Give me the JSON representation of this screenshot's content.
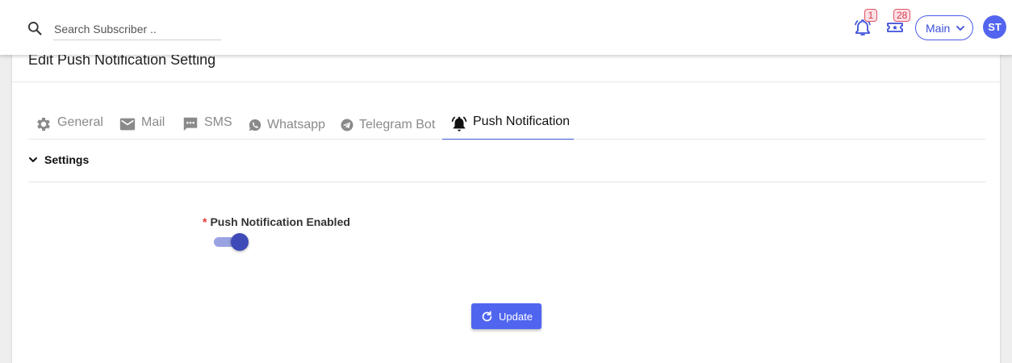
{
  "header": {
    "search": {
      "placeholder": "Search Subscriber .."
    },
    "notifications": {
      "count": "1",
      "icon": "bell-icon"
    },
    "tickets": {
      "count": "28",
      "icon": "ticket-icon"
    },
    "workspace_select": {
      "value": "Main"
    },
    "avatar": {
      "initials": "ST"
    }
  },
  "card": {
    "title": "Edit Push Notification Setting",
    "tabs": [
      {
        "label": "General",
        "icon": "gear-icon",
        "active": false
      },
      {
        "label": "Mail",
        "icon": "mail-icon",
        "active": false
      },
      {
        "label": "SMS",
        "icon": "sms-icon",
        "active": false
      },
      {
        "label": "Whatsapp",
        "icon": "whatsapp-icon",
        "active": false
      },
      {
        "label": "Telegram Bot",
        "icon": "telegram-icon",
        "active": false
      },
      {
        "label": "Push Notification",
        "icon": "bell-ring-icon",
        "active": true
      }
    ],
    "section": {
      "label": "Settings",
      "expanded": true
    },
    "field": {
      "required_mark": "*",
      "label": "Push Notification Enabled",
      "enabled": true
    },
    "update_button": {
      "label": "Update"
    }
  },
  "colors": {
    "accent": "#4f65f0",
    "badge_border": "#e0566a",
    "toggle_thumb": "#3e4ab8",
    "page_bg": "#eeeeee"
  }
}
